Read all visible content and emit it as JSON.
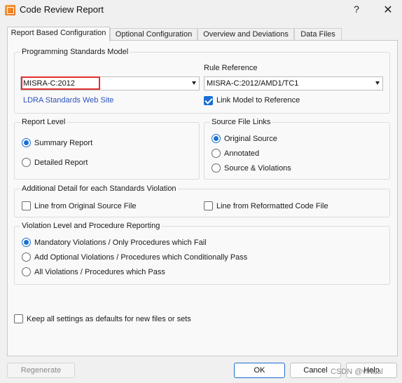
{
  "window": {
    "title": "Code Review Report",
    "help_glyph": "?",
    "close_glyph": "✕"
  },
  "tabs": [
    {
      "label": "Report Based Configuration",
      "active": true
    },
    {
      "label": "Optional Configuration",
      "active": false
    },
    {
      "label": "Overview and Deviations",
      "active": false
    },
    {
      "label": "Data Files",
      "active": false
    }
  ],
  "standards": {
    "legend": "Programming Standards Model",
    "model_value": "MISRA-C:2012",
    "rule_reference_label": "Rule Reference",
    "rule_reference_value": "MISRA-C:2012/AMD1/TC1",
    "web_site_link": "LDRA Standards Web Site",
    "link_model_label": "Link Model to Reference",
    "link_model_checked": true
  },
  "report_level": {
    "legend": "Report Level",
    "options": [
      {
        "label": "Summary Report",
        "selected": true
      },
      {
        "label": "Detailed Report",
        "selected": false
      }
    ]
  },
  "source_links": {
    "legend": "Source File Links",
    "options": [
      {
        "label": "Original Source",
        "selected": true
      },
      {
        "label": "Annotated",
        "selected": false
      },
      {
        "label": "Source & Violations",
        "selected": false
      }
    ]
  },
  "additional_detail": {
    "legend": "Additional Detail for each Standards Violation",
    "options": [
      {
        "label": "Line from Original Source File",
        "checked": false
      },
      {
        "label": "Line from Reformatted Code File",
        "checked": false
      }
    ]
  },
  "violation_level": {
    "legend": "Violation Level and Procedure Reporting",
    "options": [
      {
        "label": "Mandatory Violations / Only Procedures which Fail",
        "selected": true
      },
      {
        "label": "Add Optional Violations / Procedures which Conditionally Pass",
        "selected": false
      },
      {
        "label": "All Violations / Procedures which Pass",
        "selected": false
      }
    ]
  },
  "defaults": {
    "label": "Keep all settings as defaults for new files or sets",
    "checked": false
  },
  "buttons": {
    "regenerate": "Regenerate",
    "ok": "OK",
    "cancel": "Cancel",
    "help": "Help"
  },
  "watermark": "CSDN @virtual",
  "colors": {
    "accent": "#1a6fd1",
    "link": "#2a52be",
    "highlight": "#e03030"
  }
}
